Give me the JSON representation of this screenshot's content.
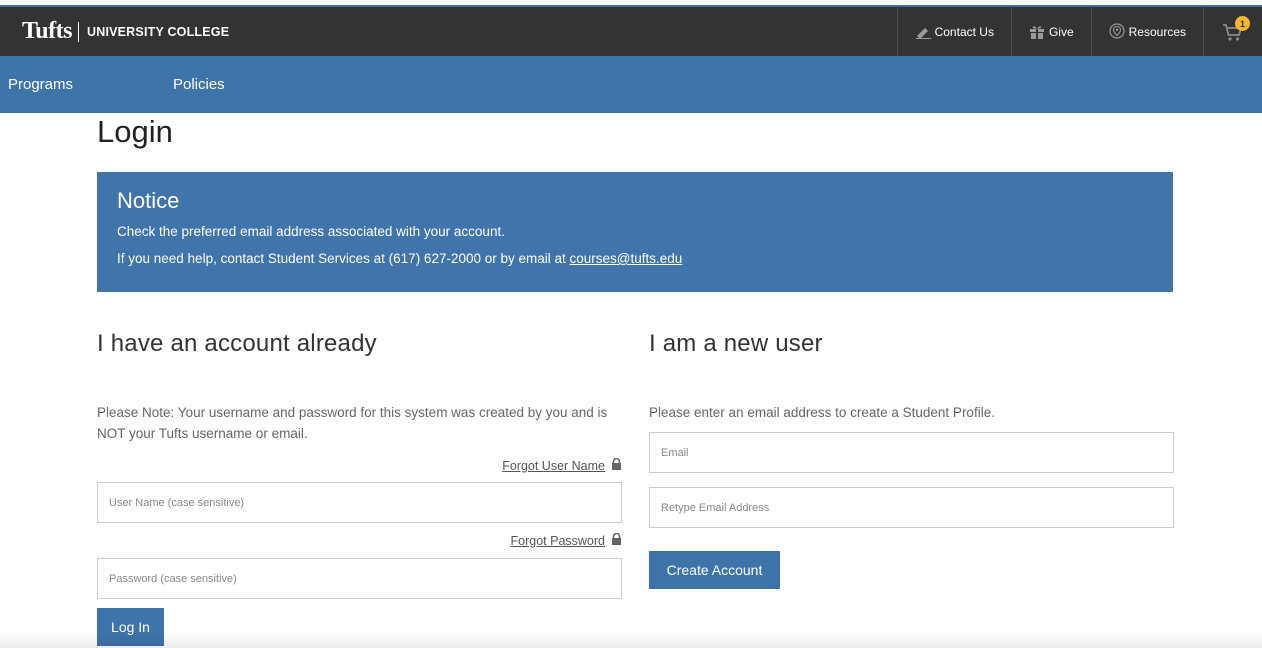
{
  "header": {
    "brand_name": "Tufts",
    "brand_sub": "UNIVERSITY COLLEGE",
    "utility": [
      {
        "label": "Contact Us",
        "icon": "pencil-icon"
      },
      {
        "label": "Give",
        "icon": "gift-icon"
      },
      {
        "label": "Resources",
        "icon": "location-pin-icon"
      }
    ],
    "cart": {
      "icon": "cart-icon",
      "count": "1"
    }
  },
  "nav": {
    "items": [
      "Programs",
      "Policies"
    ]
  },
  "page": {
    "title": "Login"
  },
  "notice": {
    "title": "Notice",
    "line1": "Check the preferred email address associated with your account.",
    "line2_prefix": "If you need help, contact Student Services at (617) 627-2000 or by email at ",
    "email_link": "courses@tufts.edu"
  },
  "existing": {
    "heading": "I have an account already",
    "note": "Please Note: Your username and password for this system was created by you and is NOT your Tufts username or email.",
    "forgot_user": "Forgot User Name",
    "username_placeholder": "User Name (case sensitive)",
    "username_value": "",
    "forgot_password": "Forgot Password",
    "password_placeholder": "Password (case sensitive)",
    "password_value": "",
    "login_button": "Log In"
  },
  "new_user": {
    "heading": "I am a new user",
    "note": "Please enter an email address to create a Student Profile.",
    "email_placeholder": "Email",
    "email_value": "",
    "retype_placeholder": "Retype Email Address",
    "retype_value": "",
    "create_button": "Create Account"
  },
  "colors": {
    "topbar": "#333333",
    "navbar": "#3e74aa",
    "notice": "#4174aa",
    "badge": "#f2b632"
  }
}
